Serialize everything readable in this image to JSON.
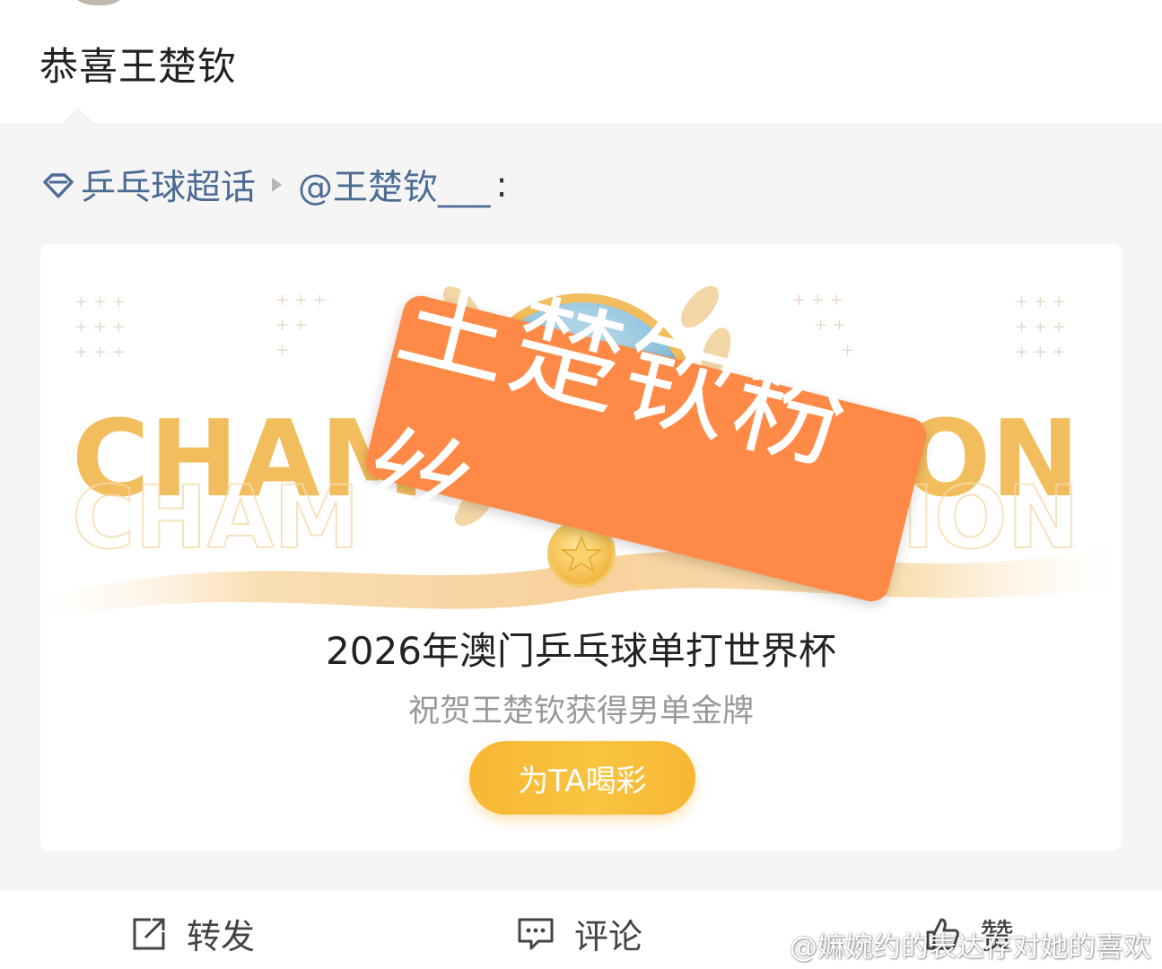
{
  "post": {
    "text": "恭喜王楚钦"
  },
  "repost": {
    "topic": "乒乓球超话",
    "author": "@王楚钦___",
    "colon": ":"
  },
  "card": {
    "banner_word_left": "CHAM",
    "banner_word_right": "PION",
    "title": "2026年澳门乒乓球单打世界杯",
    "subtitle": "祝贺王楚钦获得男单金牌",
    "cheer_button": "为TA喝彩"
  },
  "stamp": {
    "text": "王楚钦粉丝",
    "color": "#ff8a47"
  },
  "actions": {
    "repost": "转发",
    "comment": "评论",
    "like": "赞"
  },
  "watermark": {
    "text": "@嫲婉约的表达存对她的喜欢"
  },
  "colors": {
    "link": "#4d6c94",
    "gold": "#f2bd5c",
    "button": "#f9c440"
  }
}
